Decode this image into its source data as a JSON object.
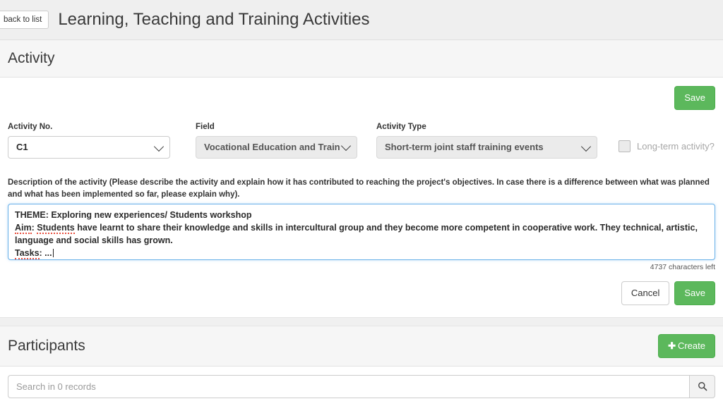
{
  "topbar": {
    "back_label": "back to list",
    "page_title": "Learning, Teaching and Training Activities"
  },
  "activity_section": {
    "title": "Activity",
    "save_top_label": "Save",
    "fields": {
      "activity_no": {
        "label": "Activity No.",
        "value": "C1",
        "disabled": false
      },
      "field": {
        "label": "Field",
        "value": "Vocational Education and Train",
        "disabled": true
      },
      "activity_type": {
        "label": "Activity Type",
        "value": "Short-term joint staff training events",
        "disabled": true
      },
      "long_term": {
        "label": "Long-term activity?",
        "checked": false,
        "disabled": true
      }
    },
    "description": {
      "label": "Description of the activity (Please describe the activity and explain how it has contributed to reaching the project's objectives. In case there is a difference between what was planned and what has been implemented so far, please explain why).",
      "lines": [
        "THEME: Exploring new experiences/ Students workshop",
        "Aim: Students have learnt to share their knowledge and skills in intercultural group and they become more competent in cooperative work. They technical, artistic,",
        "language and social skills has grown.",
        "Tasks: ..."
      ],
      "line2_spell_a": "Aim",
      "line2_spell_b": "Students",
      "line2_rest": " have learnt to share their knowledge and skills in intercultural group and they become more competent in cooperative work. They technical, artistic,",
      "line4_spell": "Tasks",
      "line4_rest": ": ...",
      "chars_left": "4737 characters left"
    },
    "actions": {
      "cancel_label": "Cancel",
      "save_label": "Save"
    }
  },
  "participants_section": {
    "title": "Participants",
    "create_label": "Create",
    "create_plus": "✚",
    "search_placeholder": "Search in 0 records",
    "search_value": "",
    "search_icon": "search-icon"
  },
  "colors": {
    "success": "#5cb85c",
    "focus_border": "#66afe9",
    "panel_header_bg": "#f6f6f6",
    "topbar_bg": "#efefef"
  }
}
